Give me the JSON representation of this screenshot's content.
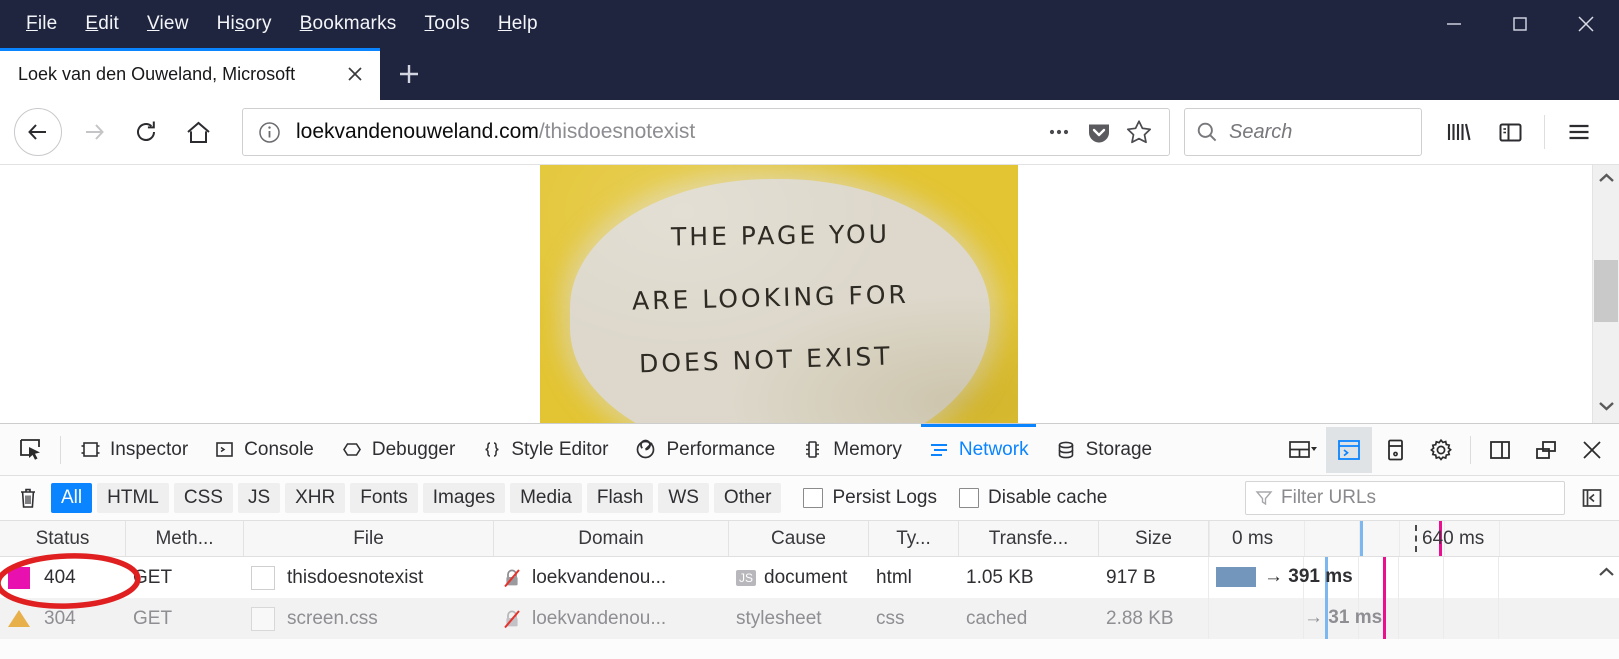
{
  "window": {
    "menus": [
      {
        "label": "File",
        "accel_index": 0
      },
      {
        "label": "Edit",
        "accel_index": 0
      },
      {
        "label": "View",
        "accel_index": 0
      },
      {
        "label": "History",
        "accel_index": 3
      },
      {
        "label": "Bookmarks",
        "accel_index": 0
      },
      {
        "label": "Tools",
        "accel_index": 0
      },
      {
        "label": "Help",
        "accel_index": 0
      }
    ],
    "controls": {
      "minimize": "minimize-icon",
      "maximize": "maximize-icon",
      "close": "close-icon"
    },
    "titlebar_color": "#20253f"
  },
  "tabs": {
    "items": [
      {
        "title": "Loek van den Ouweland, Microsoft",
        "active": true,
        "close_label": "✕"
      }
    ],
    "new_tab_label": "+"
  },
  "navbar": {
    "back_icon": "back-arrow-icon",
    "forward_icon": "forward-arrow-icon",
    "reload_icon": "reload-icon",
    "home_icon": "home-icon",
    "identity_icon": "info-circle-icon",
    "url_domain": "loekvandenouweland.com",
    "url_path": "/thisdoesnotexist",
    "page_actions_icon": "ellipsis-icon",
    "pocket_icon": "pocket-shield-icon",
    "bookmark_icon": "star-icon",
    "search": {
      "icon": "search-icon",
      "placeholder": "Search",
      "value": ""
    },
    "library_icon": "library-icon",
    "sidebar_icon": "sidebar-icon",
    "menu_icon": "hamburger-menu-icon"
  },
  "page": {
    "note": {
      "lines": [
        "THE  PAGE  YOU",
        "ARE  LOOKING  FOR",
        "DOES  NOT  EXIST"
      ],
      "paper_color": "#e3c534",
      "oval_color": "#ddd8cb",
      "ink_color": "#2e2a24"
    },
    "scrollbar": {
      "up_icon": "chevron-up-icon",
      "down_icon": "chevron-down-icon"
    }
  },
  "devtools": {
    "picker_icon": "element-picker-icon",
    "tabs": [
      {
        "label": "Inspector",
        "icon": "inspector-icon",
        "active": false
      },
      {
        "label": "Console",
        "icon": "console-icon",
        "active": false
      },
      {
        "label": "Debugger",
        "icon": "debugger-icon",
        "active": false
      },
      {
        "label": "Style Editor",
        "icon": "style-editor-icon",
        "active": false
      },
      {
        "label": "Performance",
        "icon": "performance-icon",
        "active": false
      },
      {
        "label": "Memory",
        "icon": "memory-icon",
        "active": false
      },
      {
        "label": "Network",
        "icon": "network-icon",
        "active": true
      },
      {
        "label": "Storage",
        "icon": "storage-icon",
        "active": false
      }
    ],
    "right_buttons": [
      {
        "name": "responsive-layout-icon",
        "selected": false
      },
      {
        "name": "split-console-icon",
        "selected": true
      },
      {
        "name": "responsive-design-mode-icon",
        "selected": false
      },
      {
        "name": "settings-gear-icon",
        "selected": false
      },
      {
        "name": "dock-side-icon",
        "selected": false
      },
      {
        "name": "dock-window-icon",
        "selected": false
      },
      {
        "name": "close-devtools-icon",
        "selected": false
      }
    ],
    "filterbar": {
      "clear_icon": "trash-icon",
      "chips": [
        {
          "label": "All",
          "active": true
        },
        {
          "label": "HTML",
          "active": false
        },
        {
          "label": "CSS",
          "active": false
        },
        {
          "label": "JS",
          "active": false
        },
        {
          "label": "XHR",
          "active": false
        },
        {
          "label": "Fonts",
          "active": false
        },
        {
          "label": "Images",
          "active": false
        },
        {
          "label": "Media",
          "active": false
        },
        {
          "label": "Flash",
          "active": false
        },
        {
          "label": "WS",
          "active": false
        },
        {
          "label": "Other",
          "active": false
        }
      ],
      "checkboxes": [
        {
          "label": "Persist Logs",
          "checked": false
        },
        {
          "label": "Disable cache",
          "checked": false
        }
      ],
      "filter_urls": {
        "icon": "funnel-icon",
        "placeholder": "Filter URLs",
        "value": ""
      },
      "dock_icon": "toggle-sidebar-icon"
    },
    "network": {
      "columns": [
        "Status",
        "Meth...",
        "File",
        "Domain",
        "Cause",
        "Ty...",
        "Transfe...",
        "Size"
      ],
      "timeline_ticks": [
        "0 ms",
        "640 ms"
      ],
      "rows": [
        {
          "status": "404",
          "status_color": "#e910b0",
          "status_indicator": "square",
          "method": "GET",
          "file": "thisdoesnotexist",
          "domain": "loekvandenou...",
          "domain_icon": "broken-lock-icon",
          "cause": "document",
          "cause_badge": "JS",
          "type": "html",
          "transferred": "1.05 KB",
          "size": "917 B",
          "time": "→ 391 ms",
          "has_bar": true
        },
        {
          "status": "304",
          "status_color": "#e8b04b",
          "status_indicator": "triangle",
          "method": "GET",
          "file": "screen.css",
          "domain": "loekvandenou...",
          "domain_icon": "broken-lock-icon",
          "cause": "stylesheet",
          "cause_badge": "",
          "type": "css",
          "transferred": "cached",
          "size": "2.88 KB",
          "time": "→ 31 ms",
          "has_bar": false
        }
      ]
    }
  },
  "annotation": {
    "shape": "ellipse",
    "color": "#e02020",
    "target": "404 status cell"
  }
}
